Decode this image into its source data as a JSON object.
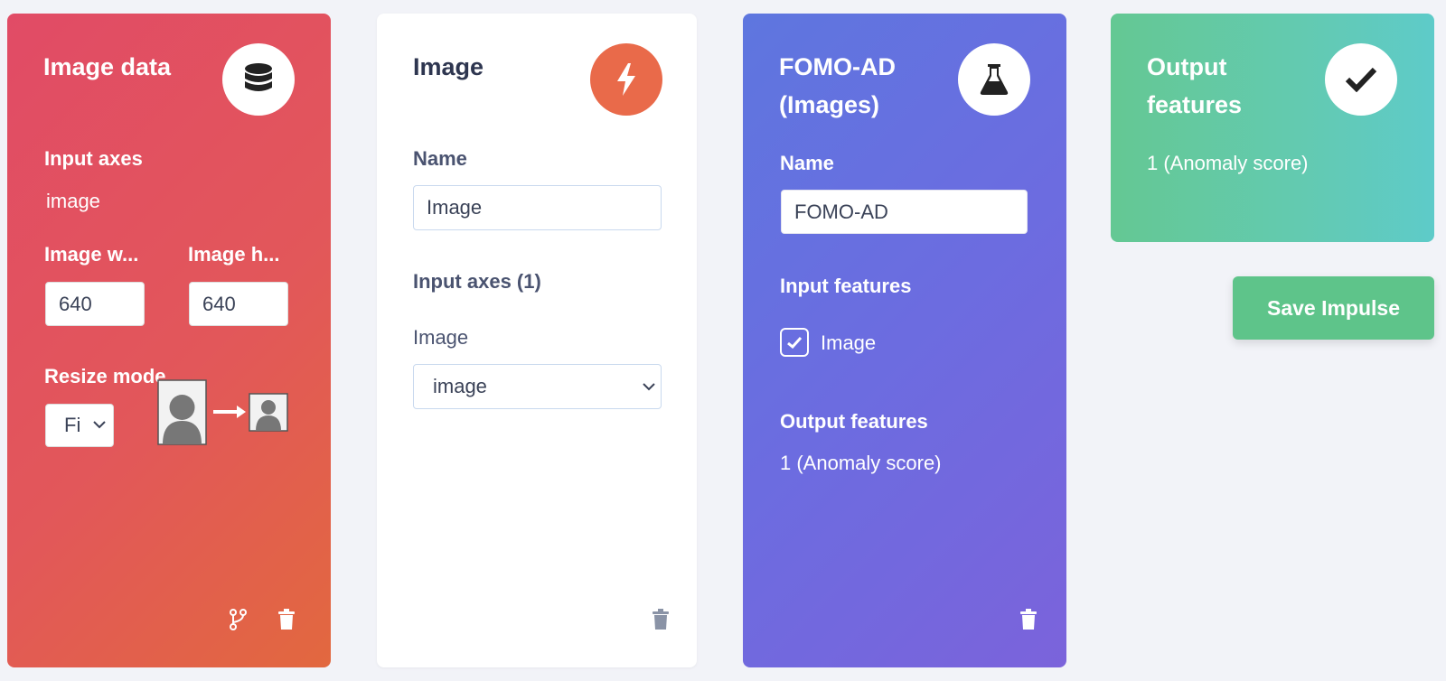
{
  "colors": {
    "input_card": "#e2575a",
    "processing_card": "#ffffff",
    "learning_card": "#6c6ce0",
    "output_card": "#63cab1",
    "save_button": "#5ec48a",
    "processing_icon_bg": "#e96a4a"
  },
  "input_block": {
    "title": "Image data",
    "icon": "database-icon",
    "input_axes_label": "Input axes",
    "input_axes_value": "image",
    "width_label": "Image w...",
    "width_value": "640",
    "height_label": "Image h...",
    "height_value": "640",
    "resize_mode_label": "Resize mode",
    "resize_mode_value": "Fi"
  },
  "processing_block": {
    "title": "Image",
    "icon": "bolt-icon",
    "name_label": "Name",
    "name_value": "Image",
    "input_axes_label": "Input axes (1)",
    "axis_label": "Image",
    "axis_value": "image"
  },
  "learning_block": {
    "title_line1": "FOMO-AD",
    "title_line2": "(Images)",
    "icon": "flask-icon",
    "name_label": "Name",
    "name_value": "FOMO-AD",
    "input_features_label": "Input features",
    "input_feature_item": "Image",
    "input_feature_checked": true,
    "output_features_label": "Output features",
    "output_features_value": "1 (Anomaly score)"
  },
  "output_block": {
    "title_line1": "Output",
    "title_line2": "features",
    "icon": "check-icon",
    "value": "1 (Anomaly score)"
  },
  "save_button": "Save Impulse"
}
